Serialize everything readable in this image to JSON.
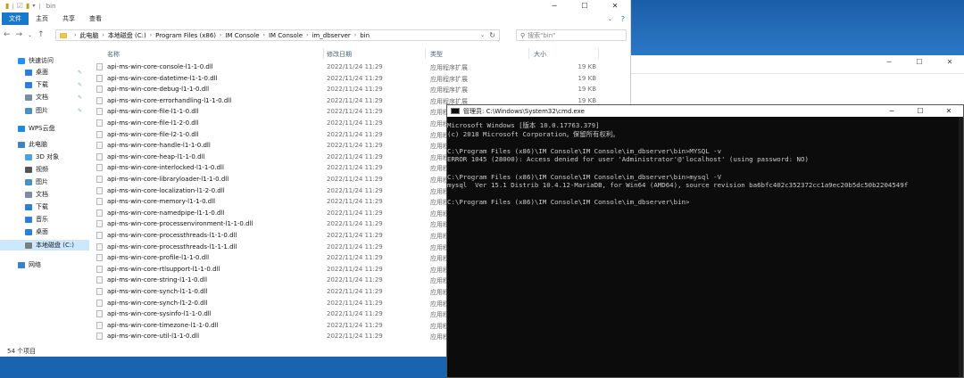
{
  "explorer": {
    "title": "bin",
    "ribbon_tabs": [
      "文件",
      "主页",
      "共享",
      "查看"
    ],
    "breadcrumb": [
      "此电脑",
      "本地磁盘 (C:)",
      "Program Files (x86)",
      "IM Console",
      "IM Console",
      "im_dbserver",
      "bin"
    ],
    "search_placeholder": "搜索\"bin\"",
    "sidebar": [
      {
        "label": "快速访问",
        "icon": "star-icon",
        "color": "#1e90ff",
        "pinned": false
      },
      {
        "label": "桌面",
        "icon": "desktop-icon",
        "color": "#2b7fd6",
        "pinned": true
      },
      {
        "label": "下载",
        "icon": "download-icon",
        "color": "#2b7fd6",
        "pinned": true
      },
      {
        "label": "文档",
        "icon": "document-icon",
        "color": "#7a8da6",
        "pinned": true
      },
      {
        "label": "图片",
        "icon": "picture-icon",
        "color": "#4a90c2",
        "pinned": true
      },
      {
        "label": "WPS云盘",
        "icon": "cloud-icon",
        "color": "#1e88e5",
        "pinned": false
      },
      {
        "label": "此电脑",
        "icon": "computer-icon",
        "color": "#3b82c4",
        "pinned": false
      },
      {
        "label": "3D 对象",
        "icon": "cube-icon",
        "color": "#4aa3df",
        "pinned": false
      },
      {
        "label": "视频",
        "icon": "video-icon",
        "color": "#555555",
        "pinned": false
      },
      {
        "label": "图片",
        "icon": "picture-icon",
        "color": "#4a90c2",
        "pinned": false
      },
      {
        "label": "文档",
        "icon": "document-icon",
        "color": "#7a8da6",
        "pinned": false
      },
      {
        "label": "下载",
        "icon": "download-icon",
        "color": "#2b7fd6",
        "pinned": false
      },
      {
        "label": "音乐",
        "icon": "music-icon",
        "color": "#2b7fd6",
        "pinned": false
      },
      {
        "label": "桌面",
        "icon": "desktop-icon",
        "color": "#2b7fd6",
        "pinned": false
      },
      {
        "label": "本地磁盘 (C:)",
        "icon": "drive-icon",
        "color": "#7d7d7d",
        "pinned": false
      },
      {
        "label": "网络",
        "icon": "network-icon",
        "color": "#3b82c4",
        "pinned": false
      }
    ],
    "columns": {
      "name": "名称",
      "date": "修改日期",
      "type": "类型",
      "size": "大小"
    },
    "files": [
      {
        "name": "api-ms-win-core-console-l1-1-0.dll",
        "date": "2022/11/24 11:29",
        "type": "应用程序扩展",
        "size": "19 KB"
      },
      {
        "name": "api-ms-win-core-datetime-l1-1-0.dll",
        "date": "2022/11/24 11:29",
        "type": "应用程序扩展",
        "size": "19 KB"
      },
      {
        "name": "api-ms-win-core-debug-l1-1-0.dll",
        "date": "2022/11/24 11:29",
        "type": "应用程序扩展",
        "size": "19 KB"
      },
      {
        "name": "api-ms-win-core-errorhandling-l1-1-0.dll",
        "date": "2022/11/24 11:29",
        "type": "应用程序扩展",
        "size": "19 KB"
      },
      {
        "name": "api-ms-win-core-file-l1-1-0.dll",
        "date": "2022/11/24 11:29",
        "type": "应用程",
        "size": ""
      },
      {
        "name": "api-ms-win-core-file-l1-2-0.dll",
        "date": "2022/11/24 11:29",
        "type": "应用程",
        "size": ""
      },
      {
        "name": "api-ms-win-core-file-l2-1-0.dll",
        "date": "2022/11/24 11:29",
        "type": "应用程",
        "size": ""
      },
      {
        "name": "api-ms-win-core-handle-l1-1-0.dll",
        "date": "2022/11/24 11:29",
        "type": "应用程",
        "size": ""
      },
      {
        "name": "api-ms-win-core-heap-l1-1-0.dll",
        "date": "2022/11/24 11:29",
        "type": "应用程",
        "size": ""
      },
      {
        "name": "api-ms-win-core-interlocked-l1-1-0.dll",
        "date": "2022/11/24 11:29",
        "type": "应用程",
        "size": ""
      },
      {
        "name": "api-ms-win-core-libraryloader-l1-1-0.dll",
        "date": "2022/11/24 11:29",
        "type": "应用程",
        "size": ""
      },
      {
        "name": "api-ms-win-core-localization-l1-2-0.dll",
        "date": "2022/11/24 11:29",
        "type": "应用程",
        "size": ""
      },
      {
        "name": "api-ms-win-core-memory-l1-1-0.dll",
        "date": "2022/11/24 11:29",
        "type": "应用程",
        "size": ""
      },
      {
        "name": "api-ms-win-core-namedpipe-l1-1-0.dll",
        "date": "2022/11/24 11:29",
        "type": "应用程",
        "size": ""
      },
      {
        "name": "api-ms-win-core-processenvironment-l1-1-0.dll",
        "date": "2022/11/24 11:29",
        "type": "应用程",
        "size": ""
      },
      {
        "name": "api-ms-win-core-processthreads-l1-1-0.dll",
        "date": "2022/11/24 11:29",
        "type": "应用程",
        "size": ""
      },
      {
        "name": "api-ms-win-core-processthreads-l1-1-1.dll",
        "date": "2022/11/24 11:29",
        "type": "应用程",
        "size": ""
      },
      {
        "name": "api-ms-win-core-profile-l1-1-0.dll",
        "date": "2022/11/24 11:29",
        "type": "应用程",
        "size": ""
      },
      {
        "name": "api-ms-win-core-rtlsupport-l1-1-0.dll",
        "date": "2022/11/24 11:29",
        "type": "应用程",
        "size": ""
      },
      {
        "name": "api-ms-win-core-string-l1-1-0.dll",
        "date": "2022/11/24 11:29",
        "type": "应用程",
        "size": ""
      },
      {
        "name": "api-ms-win-core-synch-l1-1-0.dll",
        "date": "2022/11/24 11:29",
        "type": "应用程",
        "size": ""
      },
      {
        "name": "api-ms-win-core-synch-l1-2-0.dll",
        "date": "2022/11/24 11:29",
        "type": "应用程",
        "size": ""
      },
      {
        "name": "api-ms-win-core-sysinfo-l1-1-0.dll",
        "date": "2022/11/24 11:29",
        "type": "应用程",
        "size": ""
      },
      {
        "name": "api-ms-win-core-timezone-l1-1-0.dll",
        "date": "2022/11/24 11:29",
        "type": "应用程",
        "size": ""
      },
      {
        "name": "api-ms-win-core-util-l1-1-0.dll",
        "date": "2022/11/24 11:29",
        "type": "应用程",
        "size": ""
      }
    ],
    "status": "54 个项目"
  },
  "cmd": {
    "title": "管理员: C:\\Windows\\System32\\cmd.exe",
    "lines": [
      "Microsoft Windows [版本 10.0.17763.379]",
      "(c) 2018 Microsoft Corporation。保留所有权利。",
      "",
      "C:\\Program Files (x86)\\IM Console\\IM Console\\im_dbserver\\bin>MYSQL -v",
      "ERROR 1045 (28000): Access denied for user 'Administrator'@'localhost' (using password: NO)",
      "",
      "C:\\Program Files (x86)\\IM Console\\IM Console\\im_dbserver\\bin>mysql -V",
      "mysql  Ver 15.1 Distrib 10.4.12-MariaDB, for Win64 (AMD64), source revision ba6bfc402c352372cc1a9ec20b5dc50b2204549f",
      "",
      "C:\\Program Files (x86)\\IM Console\\IM Console\\im_dbserver\\bin>"
    ]
  },
  "window_buttons": {
    "minimize": "─",
    "maximize": "☐",
    "close": "✕"
  }
}
